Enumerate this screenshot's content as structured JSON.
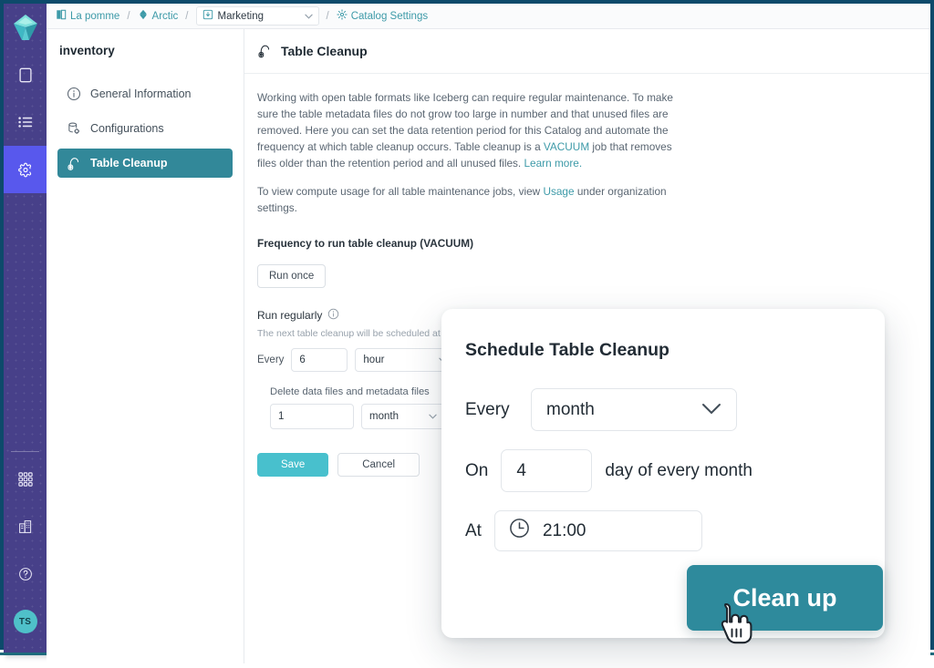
{
  "rail": {
    "logo_icon": "iceberg-diamond-logo",
    "items": [
      {
        "icon": "square-outline-icon",
        "name": "sources"
      },
      {
        "icon": "list-icon",
        "name": "jobs"
      },
      {
        "icon": "gear-icon",
        "name": "settings",
        "active": true
      }
    ],
    "bottom_items": [
      {
        "icon": "apps-grid-icon",
        "name": "apps"
      },
      {
        "icon": "building-icon",
        "name": "organization"
      },
      {
        "icon": "question-circle-icon",
        "name": "help"
      }
    ],
    "avatar_initials": "TS"
  },
  "breadcrumb": {
    "items": [
      {
        "label": "La pomme",
        "icon": "book-icon"
      },
      {
        "label": "Arctic",
        "icon": "arctic-icon"
      }
    ],
    "separator": "/",
    "selector": {
      "label": "Marketing",
      "icon": "catalog-icon",
      "caret": "∨"
    },
    "last": {
      "label": "Catalog Settings",
      "icon": "gear-icon"
    }
  },
  "settings_nav": {
    "title": "inventory",
    "items": [
      {
        "label": "General Information",
        "icon": "info-circle-icon",
        "active": false
      },
      {
        "label": "Configurations",
        "icon": "database-gear-icon",
        "active": false
      },
      {
        "label": "Table Cleanup",
        "icon": "vacuum-icon",
        "active": true
      }
    ]
  },
  "main": {
    "header": {
      "title": "Table Cleanup",
      "icon": "vacuum-icon"
    },
    "paragraph1_part1": "Working with open table formats like Iceberg can require regular maintenance. To make sure the table metadata files do not grow too large in number and that unused files are removed. Here you can set the data retention period for this Catalog and automate the frequency at which table cleanup occurs. Table cleanup is a ",
    "paragraph1_link1": "VACUUM",
    "paragraph1_part2": " job that removes files older than the retention period and all unused files. ",
    "paragraph1_link2": "Learn more.",
    "paragraph2_part1": "To view compute usage for all table maintenance jobs, view ",
    "paragraph2_link": "Usage",
    "paragraph2_part2": " under organization settings.",
    "section_title": "Frequency to run table cleanup (VACUUM)",
    "run_once_label": "Run once",
    "run_regularly_label": "Run regularly",
    "run_regularly_info_icon": "info-circle-icon",
    "schedule_hint": "The next table cleanup will be scheduled at A",
    "every_label": "Every",
    "every_value": "6",
    "every_unit": "hour",
    "retention_caption": "Delete data files and metadata files",
    "retention_value": "1",
    "retention_unit": "month",
    "save_label": "Save",
    "cancel_label": "Cancel"
  },
  "modal": {
    "title": "Schedule Table Cleanup",
    "every_label": "Every",
    "every_value": "month",
    "every_caret": "∨",
    "on_label": "On",
    "on_value": "4",
    "on_suffix": "day of every month",
    "at_label": "At",
    "at_icon": "clock-icon",
    "at_value": "21:00",
    "cta_label": "Clean up"
  },
  "colors": {
    "rail_bg": "#474089",
    "rail_active": "#5858ed",
    "nav_active": "#328899",
    "accent_link": "#3d9aa8",
    "save_button": "#48c0cd",
    "cta_button": "#2e8a9c",
    "avatar": "#4fc0c9",
    "frame_border": "#0d4a6b"
  },
  "cursor": {
    "icon": "pointing-hand-cursor"
  }
}
